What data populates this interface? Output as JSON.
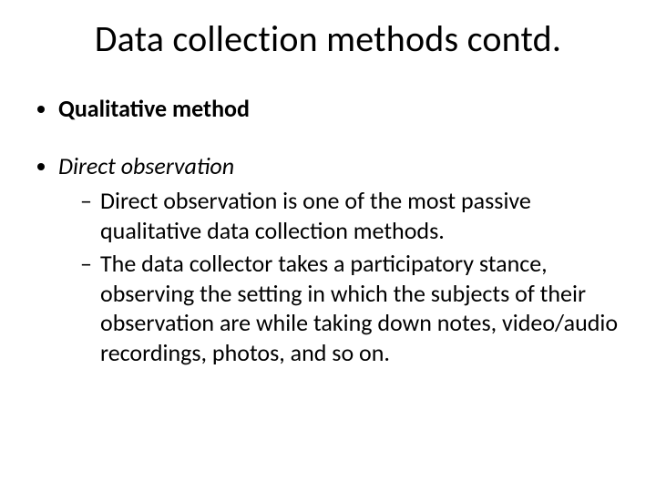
{
  "title": "Data collection methods contd.",
  "bullets": {
    "b1": "Qualitative method",
    "b2": "Direct observation",
    "sub1": "Direct observation is one of the most passive qualitative data collection methods.",
    "sub2": "The data collector takes a participatory stance, observing the setting in which the subjects of their observation are while taking down notes, video/audio recordings, photos, and so on."
  }
}
